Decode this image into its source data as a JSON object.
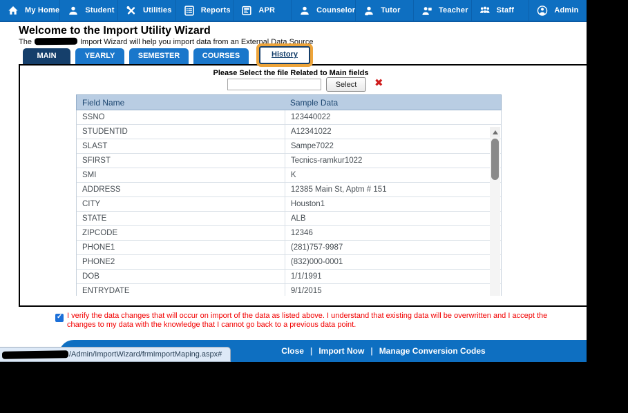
{
  "colors": {
    "navbar_blue": "#0e6fc1",
    "tab_active_navy": "#153f6b",
    "tab_blue": "#1a77cb",
    "highlight_orange": "#eda43a",
    "table_header_bg": "#b9cde3",
    "verify_text_red": "#f20000",
    "red_x": "#cf1d1d"
  },
  "navbar": {
    "items": [
      {
        "label": "My Home",
        "icon": "home-icon"
      },
      {
        "label": "Student",
        "icon": "student-icon"
      },
      {
        "label": "Utilities",
        "icon": "utilities-icon"
      },
      {
        "label": "Reports",
        "icon": "reports-icon"
      },
      {
        "label": "APR",
        "icon": "apr-icon"
      },
      {
        "label": "Counselor",
        "icon": "counselor-icon"
      },
      {
        "label": "Tutor",
        "icon": "tutor-icon"
      },
      {
        "label": "Teacher",
        "icon": "teacher-icon"
      },
      {
        "label": "Staff",
        "icon": "staff-icon"
      },
      {
        "label": "Admin",
        "icon": "admin-icon"
      }
    ]
  },
  "header": {
    "title": "Welcome to the Import Utility Wizard",
    "subtitle_prefix": "The",
    "subtitle_suffix": "Import Wizard will help you import data from an External Data Source"
  },
  "tabs": [
    {
      "label": "MAIN",
      "state": "active"
    },
    {
      "label": "YEARLY",
      "state": "normal"
    },
    {
      "label": "SEMESTER",
      "state": "normal"
    },
    {
      "label": "COURSES",
      "state": "normal"
    },
    {
      "label": "History",
      "state": "history"
    }
  ],
  "file_select": {
    "label": "Please Select the file Related to Main fields",
    "input_value": "",
    "button_label": "Select",
    "clear_icon": "red-x-icon"
  },
  "table": {
    "columns": [
      "Field Name",
      "Sample Data"
    ],
    "rows": [
      {
        "field": "SSNO",
        "sample": "123440022"
      },
      {
        "field": "STUDENTID",
        "sample": "A12341022"
      },
      {
        "field": "SLAST",
        "sample": "Sampe7022"
      },
      {
        "field": "SFIRST",
        "sample": "Tecnics-ramkur1022"
      },
      {
        "field": "SMI",
        "sample": "K"
      },
      {
        "field": "ADDRESS",
        "sample": "12385 Main St, Aptm # 151"
      },
      {
        "field": "CITY",
        "sample": "Houston1"
      },
      {
        "field": "STATE",
        "sample": "ALB"
      },
      {
        "field": "ZIPCODE",
        "sample": "12346"
      },
      {
        "field": "PHONE1",
        "sample": "(281)757-9987"
      },
      {
        "field": "PHONE2",
        "sample": "(832)000-0001"
      },
      {
        "field": "DOB",
        "sample": "1/1/1991"
      },
      {
        "field": "ENTRYDATE",
        "sample": "9/1/2015"
      }
    ]
  },
  "verify": {
    "checked": true,
    "text": "I verify the data changes that will occur on import of the data as listed above. I understand that existing data will be overwritten and I accept the changes to my data with the knowledge that I cannot go back to a previous data point."
  },
  "footer": {
    "separator": "|",
    "links": [
      "Close",
      "Import Now",
      "Manage Conversion Codes"
    ]
  },
  "statusbar": {
    "url_suffix": "/Admin/ImportWizard/frmImportMaping.aspx#"
  }
}
